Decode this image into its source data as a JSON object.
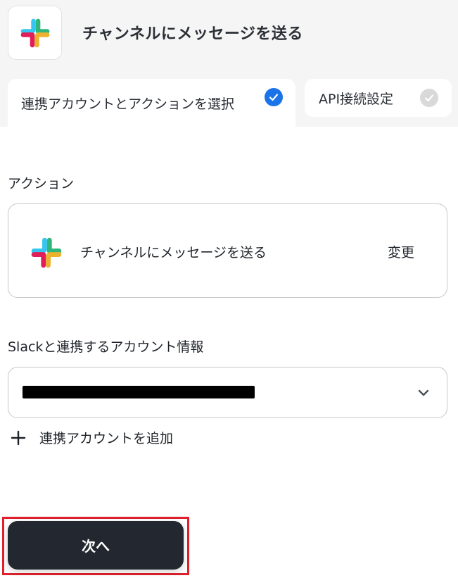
{
  "header": {
    "title": "チャンネルにメッセージを送る",
    "app_icon": "slack-logo-icon"
  },
  "tabs": [
    {
      "label": "連携アカウントとアクションを選択",
      "status": "complete",
      "check_color": "#1a73e8"
    },
    {
      "label": "API接続設定",
      "status": "incomplete",
      "check_color": "#d9d9d9"
    }
  ],
  "action_section": {
    "label": "アクション",
    "action_name": "チャンネルにメッセージを送る",
    "change_label": "変更"
  },
  "account_section": {
    "label": "Slackと連携するアカウント情報",
    "selected_value": "[redacted]"
  },
  "add_account": {
    "label": "連携アカウントを追加"
  },
  "next_button": {
    "label": "次へ",
    "highlight_color": "#e0202d"
  }
}
